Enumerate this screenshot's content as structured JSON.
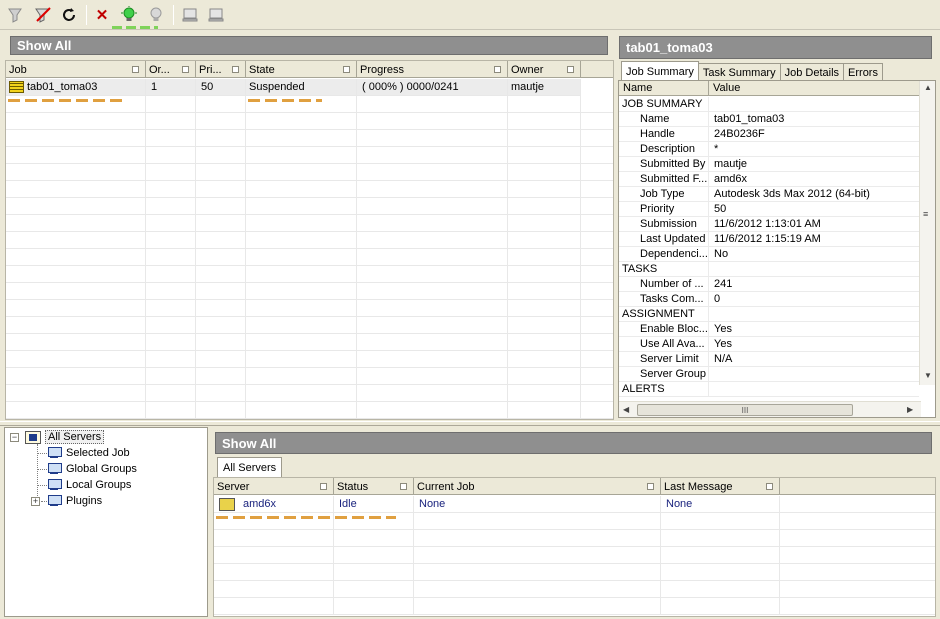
{
  "toolbar": {
    "icons": [
      "filter-icon",
      "remove-filter-icon",
      "refresh-icon",
      "delete-icon",
      "resume-bulb-icon",
      "suspend-bulb-icon",
      "monitor-icon",
      "monitor-icon-2"
    ]
  },
  "jobs": {
    "header": "Show All",
    "columns": [
      "Job",
      "Or...",
      "Pri...",
      "State",
      "Progress",
      "Owner"
    ],
    "rows": [
      {
        "job": "tab01_toma03",
        "order": "1",
        "priority": "50",
        "state": "Suspended",
        "progress": "( 000% ) 0000/0241",
        "owner": "mautje"
      }
    ]
  },
  "detail": {
    "header": "tab01_toma03",
    "tabs": [
      "Job Summary",
      "Task Summary",
      "Job Details",
      "Errors"
    ],
    "columns": [
      "Name",
      "Value"
    ],
    "rows": [
      {
        "type": "section",
        "name": "JOB SUMMARY",
        "value": ""
      },
      {
        "type": "item",
        "name": "Name",
        "value": "tab01_toma03"
      },
      {
        "type": "item",
        "name": "Handle",
        "value": "24B0236F"
      },
      {
        "type": "item",
        "name": "Description",
        "value": "*"
      },
      {
        "type": "item",
        "name": "Submitted By",
        "value": "mautje"
      },
      {
        "type": "item",
        "name": "Submitted F...",
        "value": "amd6x"
      },
      {
        "type": "item",
        "name": "Job Type",
        "value": "Autodesk 3ds Max 2012 (64-bit)"
      },
      {
        "type": "item",
        "name": "Priority",
        "value": "50"
      },
      {
        "type": "item",
        "name": "Submission",
        "value": "11/6/2012 1:13:01 AM"
      },
      {
        "type": "item",
        "name": "Last Updated",
        "value": "11/6/2012 1:15:19 AM"
      },
      {
        "type": "item",
        "name": "Dependenci...",
        "value": "No"
      },
      {
        "type": "section",
        "name": "TASKS",
        "value": ""
      },
      {
        "type": "item",
        "name": "Number of ...",
        "value": "241"
      },
      {
        "type": "item",
        "name": "Tasks Com...",
        "value": "0"
      },
      {
        "type": "section",
        "name": "ASSIGNMENT",
        "value": ""
      },
      {
        "type": "item",
        "name": "Enable Bloc...",
        "value": "Yes"
      },
      {
        "type": "item",
        "name": "Use All Ava...",
        "value": "Yes"
      },
      {
        "type": "item",
        "name": "Server Limit",
        "value": "N/A"
      },
      {
        "type": "item",
        "name": "Server Group",
        "value": ""
      },
      {
        "type": "section",
        "name": "ALERTS",
        "value": ""
      }
    ],
    "scroll_thumb_glyph": "III"
  },
  "tree": {
    "root": "All Servers",
    "children": [
      "Selected Job",
      "Global Groups",
      "Local Groups",
      "Plugins"
    ]
  },
  "servers": {
    "header": "Show All",
    "tab": "All Servers",
    "columns": [
      "Server",
      "Status",
      "Current Job",
      "Last Message"
    ],
    "rows": [
      {
        "server": "amd6x",
        "status": "Idle",
        "current_job": "None",
        "last_message": "None"
      }
    ]
  },
  "colors": {
    "header_bg": "#8f8f8f",
    "server_text": "#1a237e",
    "highlight_dash": "#e0a040",
    "green_dash": "#7fd35a"
  }
}
